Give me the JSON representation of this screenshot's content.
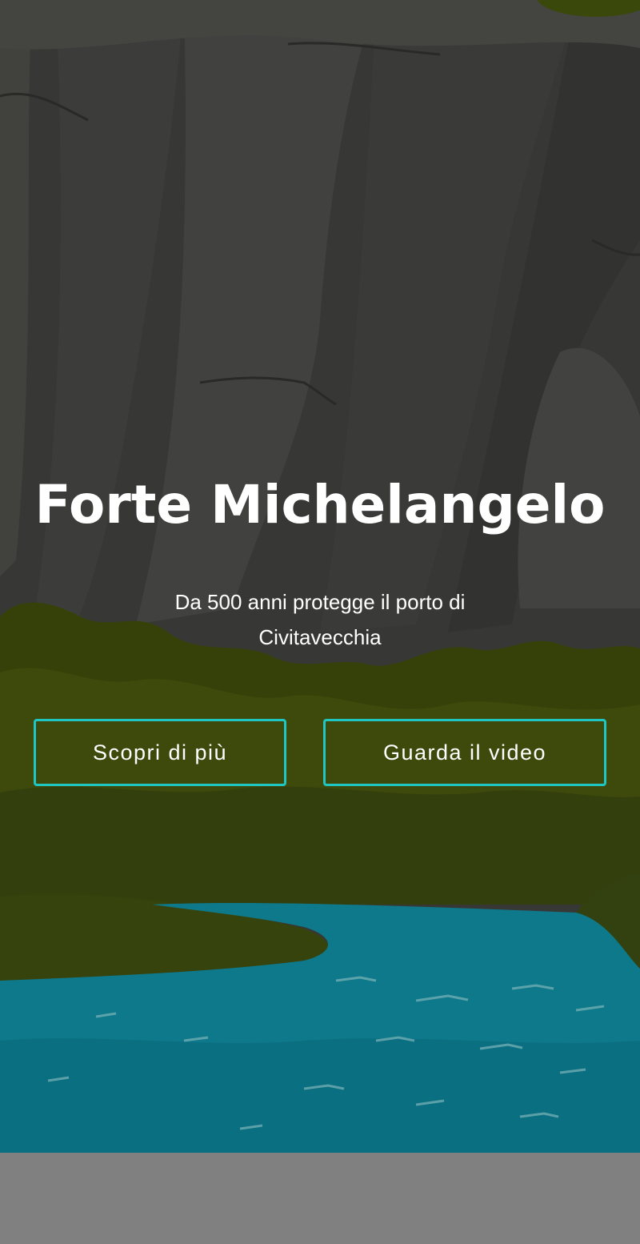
{
  "hero": {
    "title": "Forte Michelangelo",
    "subtitle": "Da 500 anni protegge il porto di Civitavecchia",
    "background": "illustrated-cliff-forest-river"
  },
  "buttons": {
    "discover_label": "Scopri di più",
    "video_label": "Guarda il video"
  },
  "colors": {
    "accent_border": "#1fc6c2",
    "text": "#ffffff",
    "rock": "#444542",
    "forest": "#44520d",
    "water": "#0f8a9e",
    "bottom_band": "#808080"
  }
}
